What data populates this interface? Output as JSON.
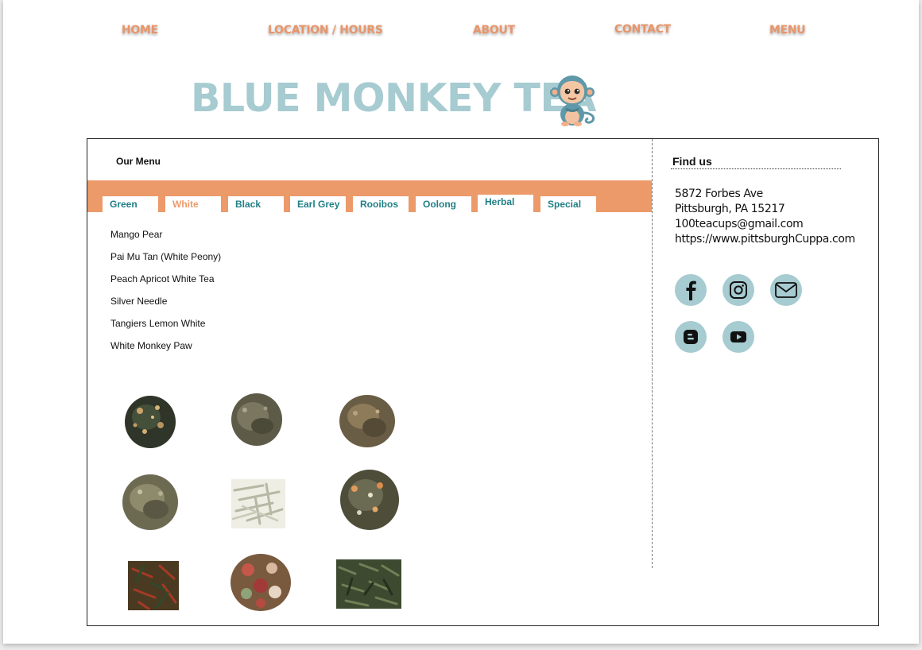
{
  "nav": {
    "home": "HOME",
    "location": "LOCATION / HOURS",
    "about": "ABOUT",
    "contact": "CONTACT",
    "menu": "MENU"
  },
  "brand": {
    "title": "BLUE MONKEY TEA",
    "logo_icon": "monkey-mascot-icon"
  },
  "menu": {
    "title": "Our Menu",
    "tabs": [
      {
        "label": "Green"
      },
      {
        "label": "White",
        "active": true
      },
      {
        "label": "Black"
      },
      {
        "label": "Earl Grey"
      },
      {
        "label": "Rooibos"
      },
      {
        "label": "Oolong"
      },
      {
        "label": "Herbal"
      },
      {
        "label": "Special"
      }
    ],
    "teas": [
      "Mango Pear",
      "Pai Mu Tan (White Peony)",
      "Peach Apricot White Tea",
      "Silver Needle",
      "Tangiers Lemon White",
      "White Monkey Paw"
    ]
  },
  "find_us": {
    "title": "Find us",
    "address_line1": "5872 Forbes Ave",
    "address_line2": "Pittsburgh, PA 15217",
    "email": "100teacups@gmail.com",
    "website": "https://www.pittsburghCuppa.com",
    "social": [
      "facebook-icon",
      "instagram-icon",
      "mail-icon",
      "blogger-icon",
      "youtube-icon"
    ]
  },
  "colors": {
    "accent_orange": "#ec9a6a",
    "brand_blue": "#a6cbd0",
    "tab_text": "#1f7f86"
  }
}
